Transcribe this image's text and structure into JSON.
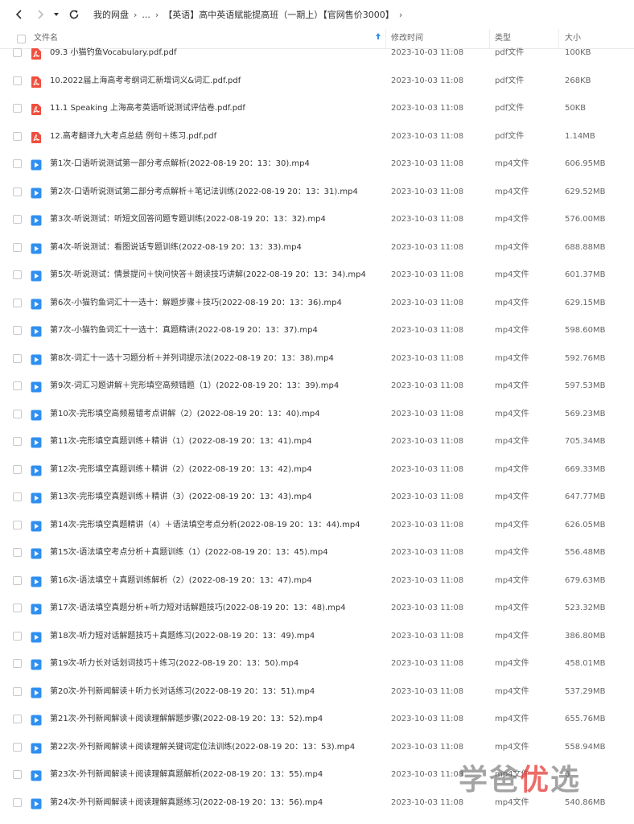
{
  "toolbar": {
    "breadcrumb": {
      "root": "我的网盘",
      "ellipsis": "...",
      "current": "【英语】高中英语赋能提高班（一期上）【官网售价3000】"
    }
  },
  "columns": {
    "name": "文件名",
    "modified": "修改时间",
    "type": "类型",
    "size": "大小"
  },
  "colors": {
    "pdf": "#f04e3e",
    "video": "#2f8ff0",
    "sort_arrow": "#2f8ff0"
  },
  "files": [
    {
      "name": "09.3 小猫钓鱼Vocabulary.pdf.pdf",
      "date": "2023-10-03 11:08",
      "type": "pdf文件",
      "size": "100KB",
      "icon": "pdf-icon"
    },
    {
      "name": "10.2022届上海高考考纲词汇新增词义&词汇.pdf.pdf",
      "date": "2023-10-03 11:08",
      "type": "pdf文件",
      "size": "268KB",
      "icon": "pdf-icon"
    },
    {
      "name": "11.1 Speaking 上海高考英语听说测试评估卷.pdf.pdf",
      "date": "2023-10-03 11:08",
      "type": "pdf文件",
      "size": "50KB",
      "icon": "pdf-icon"
    },
    {
      "name": "12.高考翻译九大考点总结 例句＋练习.pdf.pdf",
      "date": "2023-10-03 11:08",
      "type": "pdf文件",
      "size": "1.14MB",
      "icon": "pdf-icon"
    },
    {
      "name": "第1次-口语听说测试第一部分考点解析(2022-08-19 20：13：30).mp4",
      "date": "2023-10-03 11:08",
      "type": "mp4文件",
      "size": "606.95MB",
      "icon": "video-icon"
    },
    {
      "name": "第2次-口语听说测试第二部分考点解析＋笔记法训练(2022-08-19 20：13：31).mp4",
      "date": "2023-10-03 11:08",
      "type": "mp4文件",
      "size": "629.52MB",
      "icon": "video-icon"
    },
    {
      "name": "第3次-听说测试：听短文回答问题专题训练(2022-08-19 20：13：32).mp4",
      "date": "2023-10-03 11:08",
      "type": "mp4文件",
      "size": "576.00MB",
      "icon": "video-icon"
    },
    {
      "name": "第4次-听说测试：看图说话专题训练(2022-08-19 20：13：33).mp4",
      "date": "2023-10-03 11:08",
      "type": "mp4文件",
      "size": "688.88MB",
      "icon": "video-icon"
    },
    {
      "name": "第5次-听说测试：情景提问＋快问快答＋朗读技巧讲解(2022-08-19 20：13：34).mp4",
      "date": "2023-10-03 11:08",
      "type": "mp4文件",
      "size": "601.37MB",
      "icon": "video-icon"
    },
    {
      "name": "第6次-小猫钓鱼词汇十一选十：解题步骤＋技巧(2022-08-19 20：13：36).mp4",
      "date": "2023-10-03 11:08",
      "type": "mp4文件",
      "size": "629.15MB",
      "icon": "video-icon"
    },
    {
      "name": "第7次-小猫钓鱼词汇十一选十：真题精讲(2022-08-19 20：13：37).mp4",
      "date": "2023-10-03 11:08",
      "type": "mp4文件",
      "size": "598.60MB",
      "icon": "video-icon"
    },
    {
      "name": "第8次-词汇十一选十习题分析＋并列词提示法(2022-08-19 20：13：38).mp4",
      "date": "2023-10-03 11:08",
      "type": "mp4文件",
      "size": "592.76MB",
      "icon": "video-icon"
    },
    {
      "name": "第9次-词汇习题讲解＋完形填空高频错题（1）(2022-08-19 20：13：39).mp4",
      "date": "2023-10-03 11:08",
      "type": "mp4文件",
      "size": "597.53MB",
      "icon": "video-icon"
    },
    {
      "name": "第10次-完形填空高频易错考点讲解（2）(2022-08-19 20：13：40).mp4",
      "date": "2023-10-03 11:08",
      "type": "mp4文件",
      "size": "569.23MB",
      "icon": "video-icon"
    },
    {
      "name": "第11次-完形填空真题训练＋精讲（1）(2022-08-19 20：13：41).mp4",
      "date": "2023-10-03 11:08",
      "type": "mp4文件",
      "size": "705.34MB",
      "icon": "video-icon"
    },
    {
      "name": "第12次-完形填空真题训练＋精讲（2）(2022-08-19 20：13：42).mp4",
      "date": "2023-10-03 11:08",
      "type": "mp4文件",
      "size": "669.33MB",
      "icon": "video-icon"
    },
    {
      "name": "第13次-完形填空真题训练＋精讲（3）(2022-08-19 20：13：43).mp4",
      "date": "2023-10-03 11:08",
      "type": "mp4文件",
      "size": "647.77MB",
      "icon": "video-icon"
    },
    {
      "name": "第14次-完形填空真题精讲（4）＋语法填空考点分析(2022-08-19 20：13：44).mp4",
      "date": "2023-10-03 11:08",
      "type": "mp4文件",
      "size": "626.05MB",
      "icon": "video-icon"
    },
    {
      "name": "第15次-语法填空考点分析＋真题训练（1）(2022-08-19 20：13：45).mp4",
      "date": "2023-10-03 11:08",
      "type": "mp4文件",
      "size": "556.48MB",
      "icon": "video-icon"
    },
    {
      "name": "第16次-语法填空＋真题训练解析（2）(2022-08-19 20：13：47).mp4",
      "date": "2023-10-03 11:08",
      "type": "mp4文件",
      "size": "679.63MB",
      "icon": "video-icon"
    },
    {
      "name": "第17次-语法填空真题分析+听力短对话解题技巧(2022-08-19 20：13：48).mp4",
      "date": "2023-10-03 11:08",
      "type": "mp4文件",
      "size": "523.32MB",
      "icon": "video-icon"
    },
    {
      "name": "第18次-听力短对话解题技巧＋真题练习(2022-08-19 20：13：49).mp4",
      "date": "2023-10-03 11:08",
      "type": "mp4文件",
      "size": "386.80MB",
      "icon": "video-icon"
    },
    {
      "name": "第19次-听力长对话划词技巧＋练习(2022-08-19 20：13：50).mp4",
      "date": "2023-10-03 11:08",
      "type": "mp4文件",
      "size": "458.01MB",
      "icon": "video-icon"
    },
    {
      "name": "第20次-外刊新闻解读＋听力长对话练习(2022-08-19 20：13：51).mp4",
      "date": "2023-10-03 11:08",
      "type": "mp4文件",
      "size": "537.29MB",
      "icon": "video-icon"
    },
    {
      "name": "第21次-外刊新闻解读＋阅读理解解题步骤(2022-08-19 20：13：52).mp4",
      "date": "2023-10-03 11:08",
      "type": "mp4文件",
      "size": "655.76MB",
      "icon": "video-icon"
    },
    {
      "name": "第22次-外刊新闻解读＋阅读理解关键词定位法训练(2022-08-19 20：13：53).mp4",
      "date": "2023-10-03 11:08",
      "type": "mp4文件",
      "size": "558.94MB",
      "icon": "video-icon"
    },
    {
      "name": "第23次-外刊新闻解读＋阅读理解真题解析(2022-08-19 20：13：55).mp4",
      "date": "2023-10-03 11:08",
      "type": "mp4文件",
      "size": "6",
      "icon": "video-icon"
    },
    {
      "name": "第24次-外刊新闻解读＋阅读理解真题练习(2022-08-19 20：13：56).mp4",
      "date": "2023-10-03 11:08",
      "type": "mp4文件",
      "size": "540.86MB",
      "icon": "video-icon"
    }
  ],
  "watermark": {
    "part1": "学爸",
    "part2": "优",
    "part3": "选"
  }
}
